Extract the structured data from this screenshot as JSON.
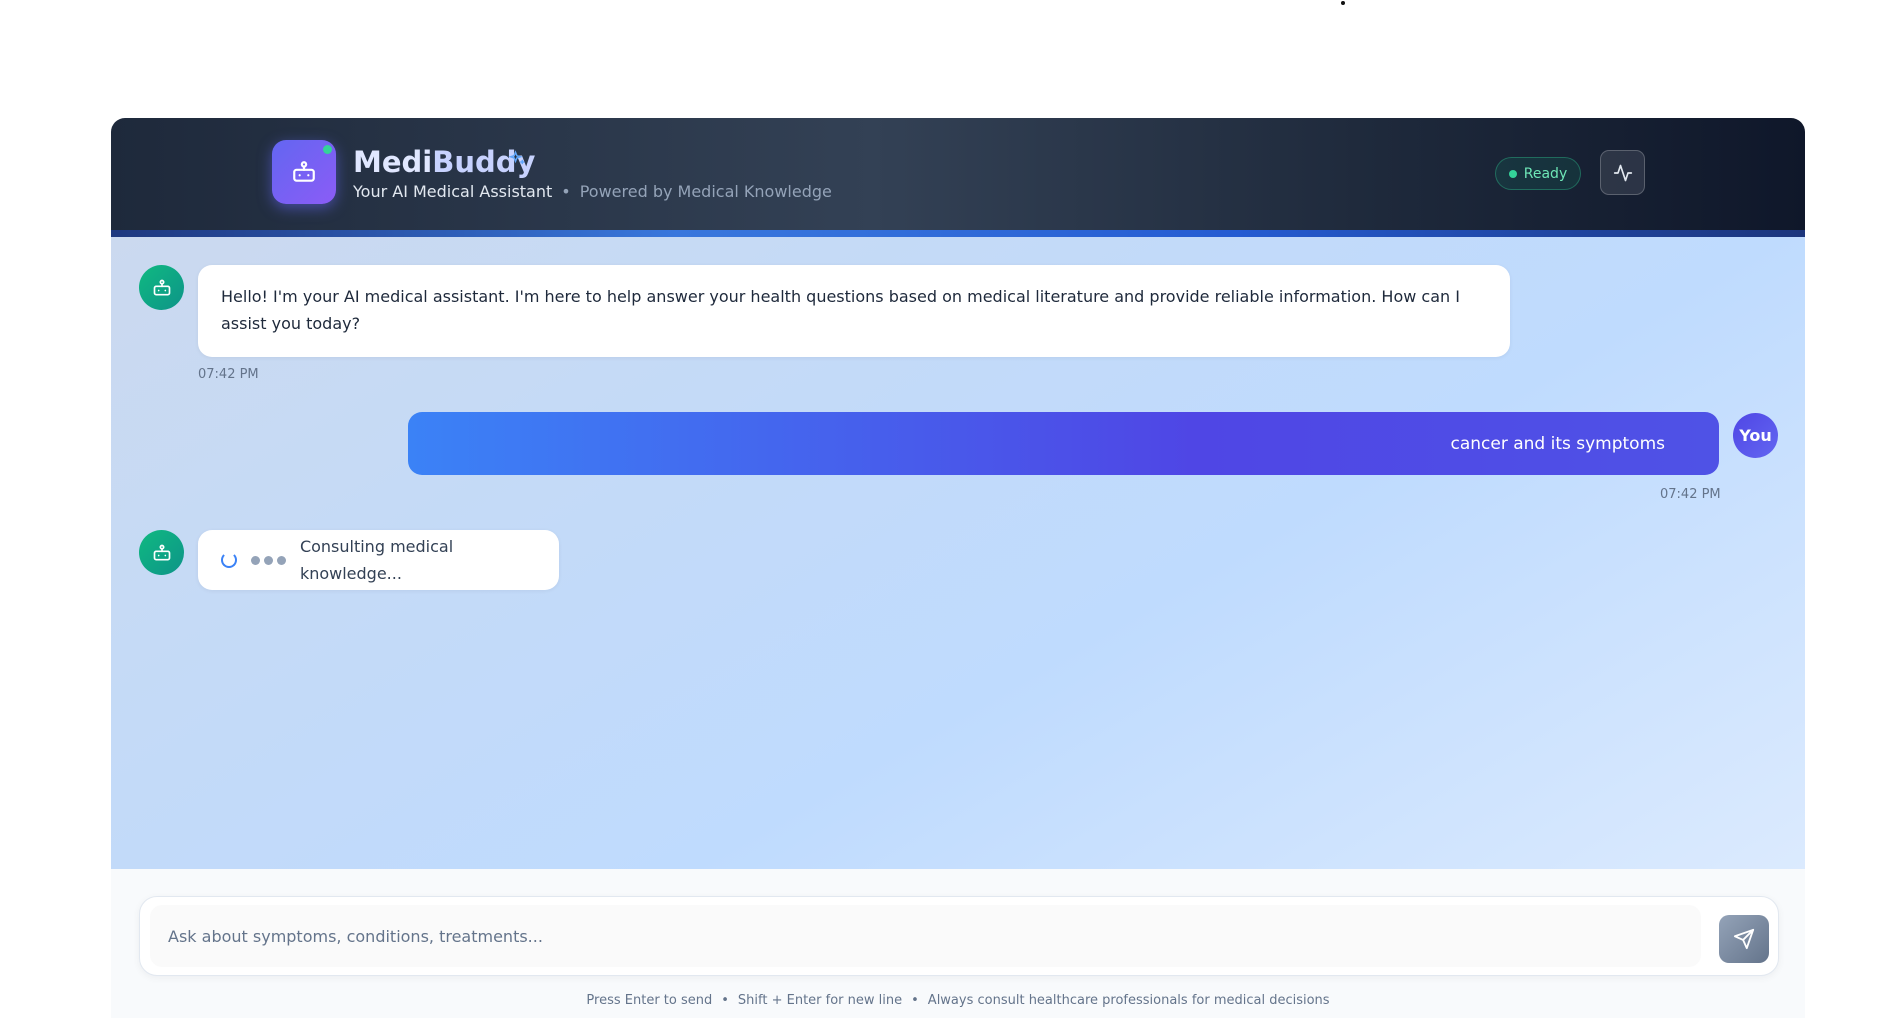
{
  "header": {
    "brand_first": "Medi",
    "brand_second": "Buddy",
    "subtitle_primary": "Your AI Medical Assistant",
    "subtitle_separator": "•",
    "subtitle_secondary": "Powered by Medical Knowledge",
    "status_label": "Ready",
    "logo_icon": "bot-icon",
    "sparkle_icon": "sparkles-icon",
    "activity_icon": "activity-icon"
  },
  "messages": [
    {
      "role": "assistant",
      "text": "Hello! I'm your AI medical assistant. I'm here to help answer your health questions based on medical literature and provide reliable information. How can I assist you today?",
      "time": "07:42 PM"
    },
    {
      "role": "user",
      "avatar_label": "You",
      "text": "cancer and its symptoms",
      "time": "07:42 PM"
    },
    {
      "role": "assistant",
      "loading": true,
      "text": "Consulting medical knowledge..."
    }
  ],
  "composer": {
    "placeholder": "Ask about symptoms, conditions, treatments...",
    "value": "",
    "send_icon": "send-icon",
    "hints": [
      "Press Enter to send",
      "Shift + Enter for new line",
      "Always consult healthcare professionals for medical decisions"
    ],
    "hint_separator": "•"
  },
  "colors": {
    "header_dark": "#1e293b",
    "accent_indigo": "#4f46e5",
    "accent_blue": "#3b82f6",
    "bot_green": "#10b981",
    "ready_green": "#6ee7b7"
  }
}
